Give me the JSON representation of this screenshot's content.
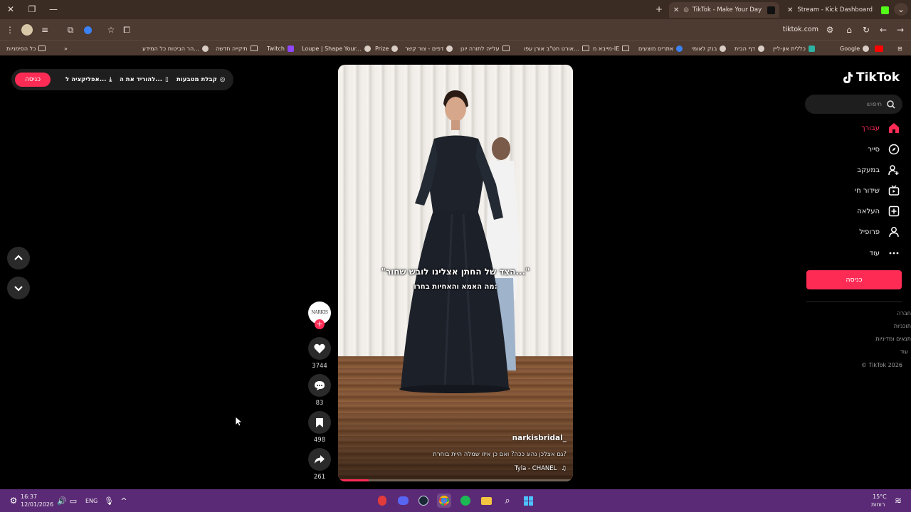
{
  "browser": {
    "tabs": [
      {
        "title": "TikTok - Make Your Day",
        "active": true
      },
      {
        "title": "Stream - Kick Dashboard",
        "active": false
      }
    ],
    "url": "tiktok.com",
    "bookmarks": [
      {
        "label": "Google",
        "icon": "google-icon"
      },
      {
        "label": "כללית און-ליין",
        "icon": "clalit-icon"
      },
      {
        "label": "דף הבית",
        "icon": "globe-icon"
      },
      {
        "label": "בנק לאומי",
        "icon": "globe-icon"
      },
      {
        "label": "אתרים מוצעים",
        "icon": "globe-icon"
      },
      {
        "label": "מייבא מ-IE",
        "icon": "folder-icon"
      },
      {
        "label": "אורט חט\"ב אורן עפו...",
        "icon": "folder-icon"
      },
      {
        "label": "עלייה לתורה יונן",
        "icon": "folder-icon"
      },
      {
        "label": "דפים - צור קשר",
        "icon": "globe-icon"
      },
      {
        "label": "Prize",
        "icon": "globe-icon"
      },
      {
        "label": "Loupe | Shape Your...",
        "icon": "globe-icon"
      },
      {
        "label": "Twitch",
        "icon": "twitch-icon"
      },
      {
        "label": "תיקייה חדשה",
        "icon": "folder-icon"
      },
      {
        "label": "הר הביטוח כל המידע...",
        "icon": "globe-icon"
      }
    ],
    "all_bookmarks": "כל הסימניות"
  },
  "topbar": {
    "login": "כניסה",
    "get_app": "אפליקציה ל...",
    "download": "להוריד את ה...",
    "coins": "קבלת מטבעות"
  },
  "video": {
    "caption_line1": "\"הצד של החתן אצלינו לובש שחור...\"",
    "caption_line2": "מה האמא והאחיות בחרו:",
    "username": "narkisbridal_",
    "description": "גם אצלכן נהוג ככה? ואם כן איזו שמלה היית בוחרת?",
    "music": "Tyla - CHANEL",
    "avatar_text": "NARKIS",
    "progress": 0.13
  },
  "actions": {
    "likes": "3744",
    "comments": "83",
    "saves": "498",
    "shares": "261"
  },
  "sidebar": {
    "logo": "TikTok",
    "search_placeholder": "חיפוש",
    "nav": [
      {
        "label": "עבורך",
        "icon": "home-icon",
        "active": true
      },
      {
        "label": "סייר",
        "icon": "compass-icon",
        "active": false
      },
      {
        "label": "במעקב",
        "icon": "following-icon",
        "active": false
      },
      {
        "label": "שידור חי",
        "icon": "live-icon",
        "active": false
      },
      {
        "label": "העלאה",
        "icon": "upload-icon",
        "active": false
      },
      {
        "label": "פרופיל",
        "icon": "profile-icon",
        "active": false
      },
      {
        "label": "עוד",
        "icon": "more-icon",
        "active": false
      }
    ],
    "login": "כניסה",
    "footer": [
      "חברה",
      "תוכניות",
      "תנאים ומדיניות",
      "עוד",
      "© TikTok 2026"
    ]
  },
  "taskbar": {
    "time": "16:37",
    "date": "12/01/2026",
    "lang": "ENG",
    "weather_temp": "15°C",
    "weather_text": "רוחות"
  },
  "colors": {
    "accent": "#fe2c55",
    "tab_bar": "#3a2b23",
    "toolbar": "#4d3a30",
    "taskbar": "#5b2a76"
  }
}
